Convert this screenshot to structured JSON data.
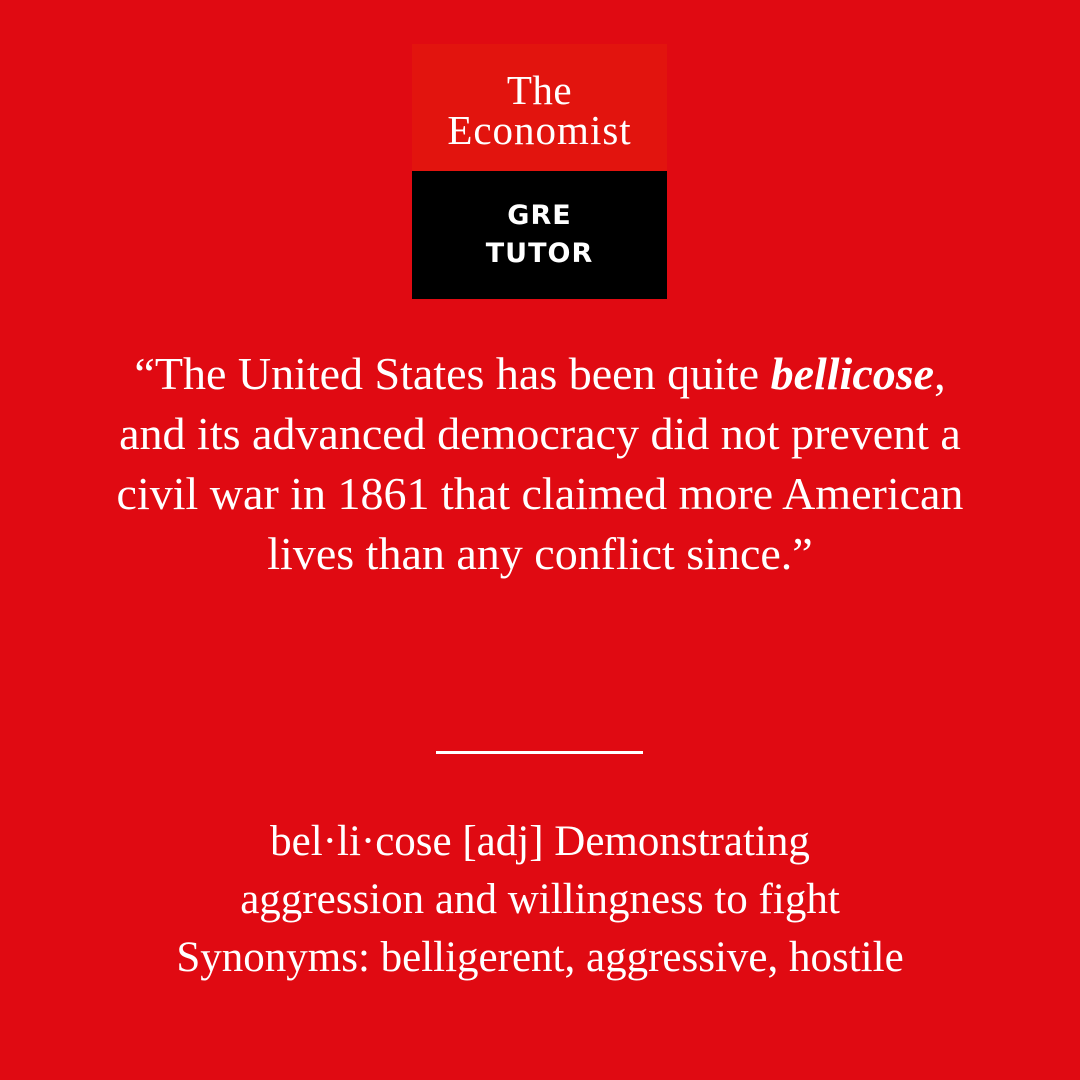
{
  "logo": {
    "line1": "The",
    "line2": "Economist",
    "sub1": "GRE",
    "sub2": "TUTOR"
  },
  "quote": {
    "open": "“The United States has been quite ",
    "term": "bellicose",
    "rest": ", and its advanced democracy did not prevent a civil war in 1861 that claimed more American lives than any conflict since.”"
  },
  "definition": {
    "line1": "bel·li·cose [adj] Demonstrating",
    "line2": "aggression and willingness to fight",
    "synonyms": "Synonyms: belligerent, aggressive, hostile"
  },
  "colors": {
    "background": "#e00a12",
    "logo_top": "#e2140e",
    "logo_bottom": "#000000",
    "text": "#ffffff"
  }
}
